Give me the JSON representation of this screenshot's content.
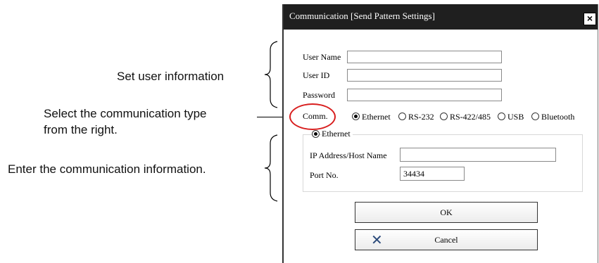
{
  "annotations": {
    "set_user_info": "Set user information",
    "select_comm_line1": "Select the communication type",
    "select_comm_line2": "from the right.",
    "enter_comm_info": "Enter the communication information."
  },
  "dialog": {
    "title": "Communication [Send Pattern Settings]",
    "close_glyph": "×",
    "user_name": {
      "label": "User Name",
      "value": ""
    },
    "user_id": {
      "label": "User ID",
      "value": ""
    },
    "password": {
      "label": "Password",
      "value": ""
    },
    "comm_label": "Comm.",
    "comm_options": [
      "Ethernet",
      "RS-232",
      "RS-422/485",
      "USB",
      "Bluetooth"
    ],
    "comm_selected": "Ethernet",
    "ethernet_group": {
      "title": "Ethernet",
      "ip_label": "IP Address/Host Name",
      "ip_value": "",
      "port_label": "Port No.",
      "port_value": "34434"
    },
    "ok_label": "OK",
    "cancel_label": "Cancel"
  },
  "colors": {
    "titlebar": "#1f1f1f",
    "highlight": "#d81e1e",
    "cancel_icon": "#2b4a7a"
  },
  "icons": {
    "close": "close-icon",
    "cancel": "cancel-x-icon"
  }
}
